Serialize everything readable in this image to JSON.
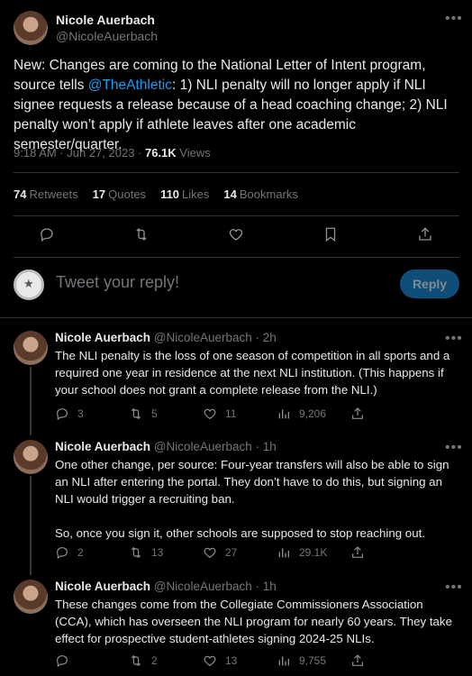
{
  "main_tweet": {
    "author_name": "Nicole Auerbach",
    "author_handle": "@NicoleAuerbach",
    "text_before": "New: Changes are coming to the National Letter of Intent program, source tells ",
    "mention": "@TheAthletic",
    "text_after": ": 1) NLI penalty will no longer apply if NLI signee requests a release because of a head coaching change; 2) NLI penalty won’t apply if athlete leaves after one academic semester/quarter.",
    "time": "9:18 AM · Jun 27, 2023 · ",
    "views_count": "76.1K",
    "views_label": " Views",
    "stats": {
      "retweets_count": "74",
      "retweets_label": "Retweets",
      "quotes_count": "17",
      "quotes_label": "Quotes",
      "likes_count": "110",
      "likes_label": "Likes",
      "bookmarks_count": "14",
      "bookmarks_label": "Bookmarks"
    },
    "more_icon": "•••"
  },
  "reply_box": {
    "placeholder": "Tweet your reply!",
    "button_label": "Reply"
  },
  "replies": [
    {
      "name": "Nicole Auerbach",
      "handle": "@NicoleAuerbach · 2h",
      "text": "The NLI penalty is the loss of one season of competition in all sports and a required one year in residence at the next NLI institution. (This happens if your school does not grant a complete release from the NLI.)",
      "replies": "3",
      "retweets": "5",
      "likes": "11",
      "views": "9,206"
    },
    {
      "name": "Nicole Auerbach",
      "handle": "@NicoleAuerbach · 1h",
      "text_p1": "One other change, per source: Four-year transfers will also be able to sign an NLI after entering the portal. They don’t have to do this, but signing an NLI would trigger a recruiting ban.",
      "text_p2": "So, once you sign it, other schools are supposed to stop reaching out.",
      "replies": "2",
      "retweets": "13",
      "likes": "27",
      "views": "29.1K"
    },
    {
      "name": "Nicole Auerbach",
      "handle": "@NicoleAuerbach · 1h",
      "text": "These changes come from the Collegiate Commissioners Association (CCA), which has overseen the NLI program for nearly 60 years. They take effect for prospective student-athletes signing 2024-25 NLIs.",
      "replies": "",
      "retweets": "2",
      "likes": "13",
      "views": "9,755"
    }
  ],
  "colors": {
    "accent": "#1d9bf0",
    "background": "#000000",
    "muted": "#71767b",
    "divider": "#2f3336"
  }
}
